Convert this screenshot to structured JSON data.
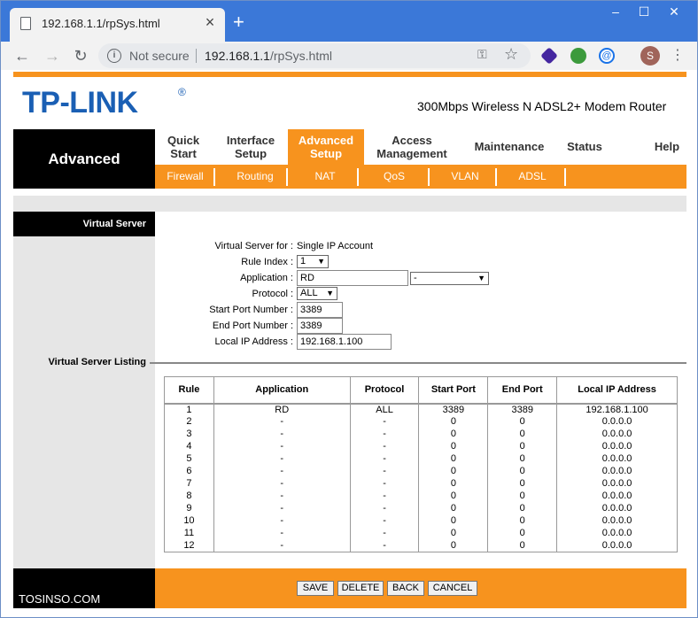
{
  "browser": {
    "tab_title": "192.168.1.1/rpSys.html",
    "tab_close": "×",
    "new_tab": "+",
    "window_controls": [
      "–",
      "☐",
      "✕"
    ],
    "nav": {
      "back": "←",
      "forward": "→",
      "reload": "↻"
    },
    "security_label": "Not secure",
    "url_host": "192.168.1.1",
    "url_path": "/rpSys.html",
    "profile_initial": "S"
  },
  "header": {
    "logo": "TP-LINK",
    "logo_mark": "®",
    "model": "300Mbps Wireless N ADSL2+ Modem Router"
  },
  "nav": {
    "section_title": "Advanced",
    "main_items": [
      {
        "label": "Quick\nStart"
      },
      {
        "label": "Interface\nSetup"
      },
      {
        "label": "Advanced\nSetup"
      },
      {
        "label": "Access\nManagement"
      },
      {
        "label": "Maintenance"
      },
      {
        "label": "Status"
      },
      {
        "label": "Help"
      }
    ],
    "sub_items": [
      "Firewall",
      "Routing",
      "NAT",
      "QoS",
      "VLAN",
      "ADSL"
    ]
  },
  "virtual_server": {
    "section_title": "Virtual Server",
    "listing_title": "Virtual Server Listing",
    "fields": {
      "for_label": "Virtual Server for :",
      "for_value": "Single IP Account",
      "rule_index_label": "Rule Index :",
      "rule_index_value": "1",
      "application_label": "Application :",
      "application_value": "RD",
      "application_select": "-",
      "protocol_label": "Protocol :",
      "protocol_value": "ALL",
      "start_port_label": "Start Port Number :",
      "start_port_value": "3389",
      "end_port_label": "End Port Number :",
      "end_port_value": "3389",
      "local_ip_label": "Local IP Address :",
      "local_ip_value": "192.168.1.100"
    },
    "table": {
      "columns": [
        "Rule",
        "Application",
        "Protocol",
        "Start Port",
        "End Port",
        "Local IP Address"
      ],
      "rows": [
        [
          "1",
          "RD",
          "ALL",
          "3389",
          "3389",
          "192.168.1.100"
        ],
        [
          "2",
          "-",
          "-",
          "0",
          "0",
          "0.0.0.0"
        ],
        [
          "3",
          "-",
          "-",
          "0",
          "0",
          "0.0.0.0"
        ],
        [
          "4",
          "-",
          "-",
          "0",
          "0",
          "0.0.0.0"
        ],
        [
          "5",
          "-",
          "-",
          "0",
          "0",
          "0.0.0.0"
        ],
        [
          "6",
          "-",
          "-",
          "0",
          "0",
          "0.0.0.0"
        ],
        [
          "7",
          "-",
          "-",
          "0",
          "0",
          "0.0.0.0"
        ],
        [
          "8",
          "-",
          "-",
          "0",
          "0",
          "0.0.0.0"
        ],
        [
          "9",
          "-",
          "-",
          "0",
          "0",
          "0.0.0.0"
        ],
        [
          "10",
          "-",
          "-",
          "0",
          "0",
          "0.0.0.0"
        ],
        [
          "11",
          "-",
          "-",
          "0",
          "0",
          "0.0.0.0"
        ],
        [
          "12",
          "-",
          "-",
          "0",
          "0",
          "0.0.0.0"
        ]
      ]
    }
  },
  "footer": {
    "buttons": [
      "SAVE",
      "DELETE",
      "BACK",
      "CANCEL"
    ],
    "brand": "TOSINSO.COM"
  },
  "colors": {
    "accent": "#f7931e",
    "brand_blue": "#1a5fb4",
    "chrome_blue": "#3b78d8"
  }
}
